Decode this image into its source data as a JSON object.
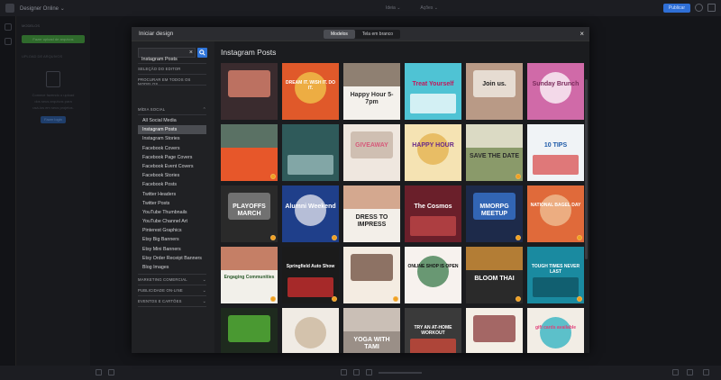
{
  "app": {
    "name": "Designer Online ⌄",
    "nav": [
      "Ideia ⌄",
      "Ações ⌄"
    ],
    "publish_label": "Publicar"
  },
  "left_panel": {
    "title": "MODELOS",
    "upload_button": "Fazer upload de arquivos",
    "uploads_header": "UPLOAD DE ARQUIVOS",
    "empty_text": [
      "Comece fazendo o upload",
      "dos seus arquivos para",
      "usá-los em seus projetos."
    ],
    "connect_button": "Fazer login"
  },
  "modal": {
    "title": "Iniciar design",
    "toggle": [
      "Modelos",
      "Tela em branco"
    ],
    "search_value": "Instagram Posts",
    "close_label": "×",
    "editor_selection": "SELEÇÃO DO EDITOR",
    "search_all": "PROCURAR EM TODOS OS MODELOS",
    "social_header": "MÍDIA SOCIAL",
    "social_items": [
      "All Social Media",
      "Instagram Posts",
      "Instagram Stories",
      "Facebook Covers",
      "Facebook Page Covers",
      "Facebook Event Covers",
      "Facebook Stories",
      "Facebook Posts",
      "Twitter Headers",
      "Twitter Posts",
      "YouTube Thumbnails",
      "YouTube Channel Art",
      "Pinterest Graphics",
      "Etsy Big Banners",
      "Etsy Mini Banners",
      "Etsy Order Receipt Banners",
      "Blog Images"
    ],
    "selected_item": "Instagram Posts",
    "collapsed_sections": [
      "MARKETING COMERCIAL",
      "PUBLICIDADE ON-LINE",
      "EVENTOS E CARTÕES"
    ],
    "content_title": "Instagram Posts"
  },
  "tiles": [
    {
      "bg": "#3a2b2e",
      "fg": "#f2e6e0",
      "text": "",
      "accent": "#e88a73"
    },
    {
      "bg": "#e0592a",
      "fg": "#ffffff",
      "text": "DREAM IT. WISH IT. DO IT.",
      "accent": "#f2c94c"
    },
    {
      "bg": "#f4f1ec",
      "fg": "#333333",
      "text": "Happy Hour 5-7pm",
      "accent": "#6e5a4a"
    },
    {
      "bg": "#4fc3d4",
      "fg": "#c2185b",
      "text": "Treat Yourself",
      "accent": "#ffffff"
    },
    {
      "bg": "#b99a86",
      "fg": "#222222",
      "text": "Join us.",
      "accent": "#f5f1eb"
    },
    {
      "bg": "#d06aa8",
      "fg": "#7a2b5b",
      "text": "Sunday Brunch",
      "accent": "#ffffff"
    },
    {
      "bg": "#e7572a",
      "fg": "#ffffff",
      "text": "",
      "accent": "#2b7a78"
    },
    {
      "bg": "#2f5a5a",
      "fg": "#e6efee",
      "text": "",
      "accent": "#9fc0c0"
    },
    {
      "bg": "#efe7df",
      "fg": "#d65a7a",
      "text": "GIVEAWAY",
      "accent": "#c4b1a3"
    },
    {
      "bg": "#f5e3b3",
      "fg": "#6a2c8a",
      "text": "HAPPY HOUR",
      "accent": "#e3b04b"
    },
    {
      "bg": "#8a9a6a",
      "fg": "#2b2b2b",
      "text": "SAVE THE DATE",
      "accent": "#f6efe3"
    },
    {
      "bg": "#f0f3f6",
      "fg": "#1e5aa8",
      "text": "10 TIPS",
      "accent": "#d94f4f"
    },
    {
      "bg": "#2a2a2a",
      "fg": "#ffffff",
      "text": "PLAYOFFS MARCH",
      "accent": "#8a8a8a"
    },
    {
      "bg": "#1f3f8a",
      "fg": "#ffffff",
      "text": "Alumni Weekend",
      "accent": "#e9e9f0"
    },
    {
      "bg": "#f3efe9",
      "fg": "#222222",
      "text": "DRESS TO IMPRESS",
      "accent": "#c99070"
    },
    {
      "bg": "#6a1f2a",
      "fg": "#ffffff",
      "text": "The Cosmos",
      "accent": "#c44a4a"
    },
    {
      "bg": "#1d2a4a",
      "fg": "#ffffff",
      "text": "MMORPG MEETUP",
      "accent": "#3a79d8"
    },
    {
      "bg": "#e06a3a",
      "fg": "#ffffff",
      "text": "NATIONAL BAGEL DAY",
      "accent": "#f0c49a"
    },
    {
      "bg": "#f2f0ea",
      "fg": "#2b5a2b",
      "text": "Engaging Communities",
      "accent": "#b55a3a"
    },
    {
      "bg": "#1b1b1b",
      "fg": "#ffffff",
      "text": "Springfield Auto Show",
      "accent": "#d62f2f"
    },
    {
      "bg": "#f4ece2",
      "fg": "#3a3a3a",
      "text": "",
      "accent": "#6b4a3a"
    },
    {
      "bg": "#f7f2ee",
      "fg": "#111111",
      "text": "ONLINE SHOP IS OPEN",
      "accent": "#3a7a4a"
    },
    {
      "bg": "#2a2a2a",
      "fg": "#ffffff",
      "text": "BLOOM THAI",
      "accent": "#e29a3a"
    },
    {
      "bg": "#1a8aa0",
      "fg": "#ffffff",
      "text": "TOUGH TIMES NEVER LAST",
      "accent": "#0f5060"
    },
    {
      "bg": "#1e2a1e",
      "fg": "#9be36a",
      "text": "",
      "accent": "#5abf3a"
    },
    {
      "bg": "#f0ebe4",
      "fg": "#5a4a3a",
      "text": "",
      "accent": "#c9b49a"
    },
    {
      "bg": "#9a8f87",
      "fg": "#ffffff",
      "text": "YOGA WITH TAMI",
      "accent": "#d9cfc6"
    },
    {
      "bg": "#3a3a3a",
      "fg": "#ffffff",
      "text": "TRY AN AT-HOME WORKOUT",
      "accent": "#d64a3a"
    },
    {
      "bg": "#f4efe6",
      "fg": "#2b2b2b",
      "text": "",
      "accent": "#8a3a3a"
    },
    {
      "bg": "#f2ede5",
      "fg": "#e0407a",
      "text": "gift cards available",
      "accent": "#2ab0c0"
    }
  ]
}
